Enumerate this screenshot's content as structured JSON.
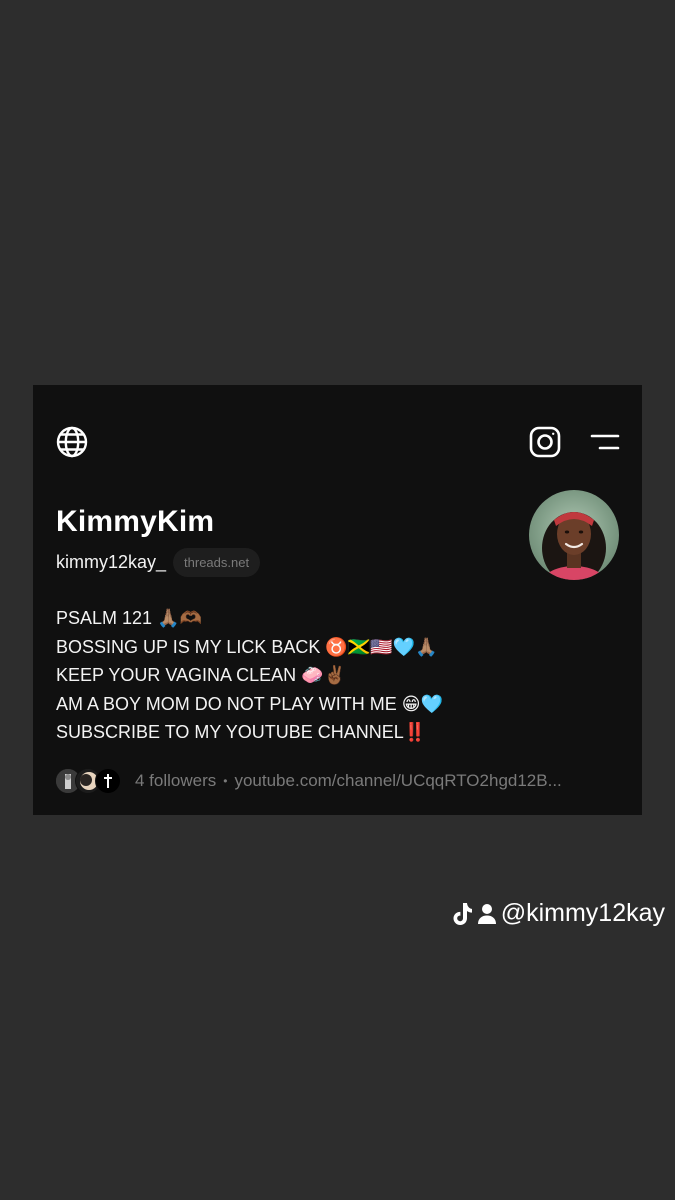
{
  "profile": {
    "name": "KimmyKim",
    "handle": "kimmy12kay_",
    "domain_badge": "threads.net",
    "bio": [
      "PSALM 121 🙏🏽🫶🏾",
      "BOSSING UP IS MY LICK BACK ♉️🇯🇲🇺🇸🩵🙏🏽",
      "KEEP YOUR VAGINA CLEAN 🧼✌🏾",
      "AM A BOY MOM DO NOT PLAY WITH ME 😁🩵",
      "SUBSCRIBE TO MY YOUTUBE CHANNEL‼️"
    ],
    "followers": "4 followers",
    "separator": "•",
    "link": "youtube.com/channel/UCqqRTO2hgd12B..."
  },
  "icons": {
    "globe": "globe-icon",
    "instagram": "instagram-icon",
    "menu": "menu-icon",
    "tiktok": "tiktok-icon",
    "user": "user-icon"
  },
  "overlay": {
    "username": "@kimmy12kay"
  },
  "colors": {
    "background": "#2d2d2d",
    "card": "#101010",
    "text": "#f3f3f3",
    "muted": "#7a7a7a",
    "pill": "#1e1e1e"
  }
}
